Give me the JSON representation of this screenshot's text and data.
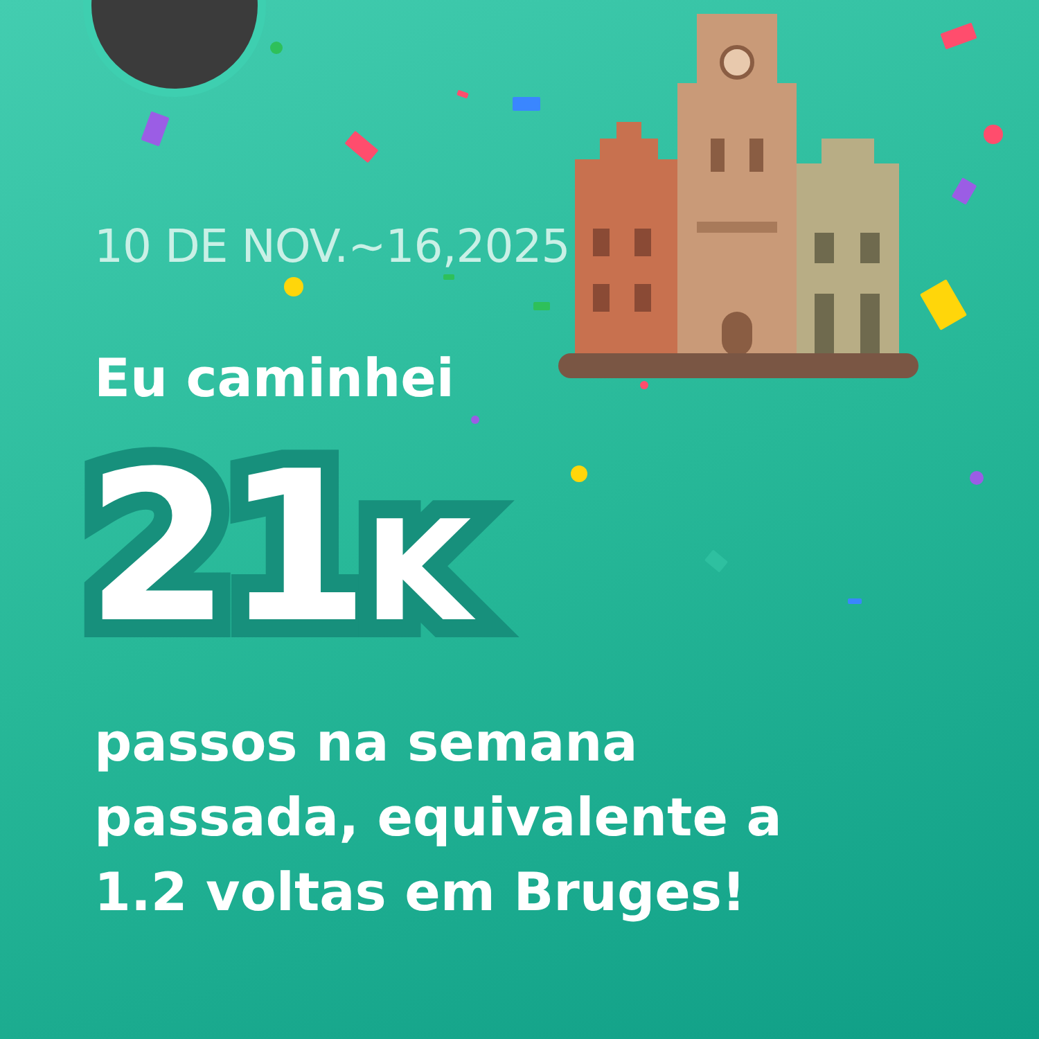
{
  "date": "10 DE NOV.~16,2025",
  "heading": "Eu caminhei",
  "big_number": {
    "value": "21",
    "unit": "K"
  },
  "description": [
    "passos na semana",
    "passada, equivalente a",
    "1.2 voltas em Bruges!"
  ]
}
